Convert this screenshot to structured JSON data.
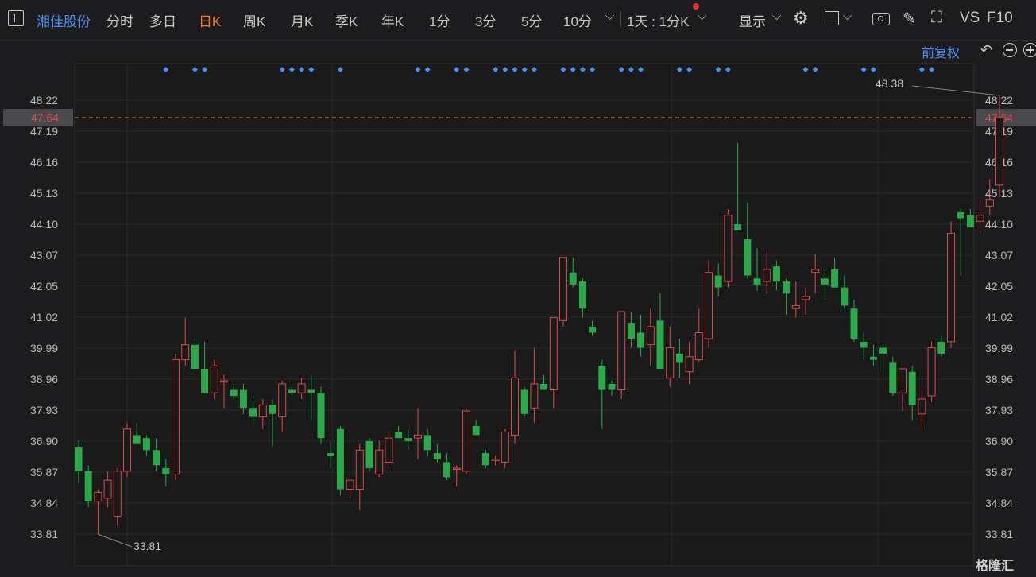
{
  "toolbar": {
    "stock_name": "湘佳股份",
    "tabs": [
      "分时",
      "多日",
      "日K",
      "周K",
      "月K",
      "季K",
      "年K",
      "1分",
      "3分",
      "5分",
      "10分"
    ],
    "active_tab": "日K",
    "period_select": "1天 : 1分K",
    "display_label": "显示",
    "vs_label": "VS",
    "f10_label": "F10"
  },
  "adjust_label": "前复权",
  "watermark": "格隆汇",
  "colors": {
    "up": "#e04848",
    "down": "#2aa84a",
    "accent": "#ff7a1a",
    "link": "#4a8ef0",
    "marker": "#4a8ef0"
  },
  "chart_data": {
    "type": "candlestick",
    "ylim": [
      33.3,
      48.9
    ],
    "y_ticks": [
      "48.22",
      "47.19",
      "46.16",
      "45.13",
      "44.10",
      "43.07",
      "42.05",
      "41.02",
      "39.99",
      "38.96",
      "37.93",
      "36.90",
      "35.87",
      "34.84",
      "33.81"
    ],
    "current_price": "47.64",
    "high_label": "48.38",
    "low_label": "33.81",
    "ohlc": [
      [
        36.7,
        36.9,
        35.5,
        35.9
      ],
      [
        35.9,
        36.1,
        34.7,
        34.9
      ],
      [
        34.9,
        35.3,
        33.8,
        35.2
      ],
      [
        35.0,
        35.9,
        34.7,
        35.6
      ],
      [
        34.4,
        36.0,
        34.1,
        35.9
      ],
      [
        35.9,
        37.5,
        35.7,
        37.3
      ],
      [
        37.1,
        37.5,
        36.8,
        36.8
      ],
      [
        37.0,
        37.1,
        36.4,
        36.6
      ],
      [
        36.6,
        37.0,
        35.9,
        36.1
      ],
      [
        36.0,
        36.3,
        35.4,
        35.8
      ],
      [
        35.8,
        39.8,
        35.6,
        39.6
      ],
      [
        39.6,
        41.0,
        39.4,
        40.1
      ],
      [
        40.1,
        40.3,
        39.2,
        39.3
      ],
      [
        39.3,
        40.2,
        38.5,
        38.5
      ],
      [
        38.5,
        39.6,
        38.3,
        39.4
      ],
      [
        38.9,
        39.1,
        38.0,
        38.9
      ],
      [
        38.6,
        38.8,
        38.3,
        38.4
      ],
      [
        38.6,
        38.8,
        37.8,
        38.0
      ],
      [
        38.0,
        38.4,
        37.4,
        37.7
      ],
      [
        37.7,
        38.3,
        37.3,
        38.1
      ],
      [
        38.1,
        38.3,
        36.7,
        37.8
      ],
      [
        37.7,
        38.9,
        37.2,
        38.8
      ],
      [
        38.6,
        38.8,
        38.4,
        38.5
      ],
      [
        38.5,
        39.0,
        38.3,
        38.8
      ],
      [
        38.6,
        39.1,
        37.6,
        38.5
      ],
      [
        38.5,
        38.7,
        36.8,
        37.0
      ],
      [
        36.5,
        36.9,
        36.0,
        36.4
      ],
      [
        37.3,
        37.4,
        35.1,
        35.3
      ],
      [
        35.3,
        35.6,
        35.0,
        35.6
      ],
      [
        35.3,
        36.8,
        34.6,
        36.6
      ],
      [
        36.9,
        37.0,
        35.9,
        36.0
      ],
      [
        35.8,
        36.9,
        35.7,
        36.6
      ],
      [
        36.2,
        37.2,
        36.0,
        37.0
      ],
      [
        37.2,
        37.4,
        37.0,
        37.0
      ],
      [
        37.0,
        37.3,
        36.6,
        36.9
      ],
      [
        37.0,
        38.0,
        36.3,
        37.1
      ],
      [
        37.1,
        37.3,
        36.4,
        36.6
      ],
      [
        36.5,
        36.8,
        36.2,
        36.3
      ],
      [
        36.2,
        36.5,
        35.6,
        35.7
      ],
      [
        36.0,
        36.1,
        35.4,
        36.0
      ],
      [
        35.9,
        38.0,
        35.8,
        37.9
      ],
      [
        37.4,
        37.6,
        37.1,
        37.1
      ],
      [
        36.5,
        36.6,
        36.0,
        36.1
      ],
      [
        36.3,
        36.4,
        36.1,
        36.3
      ],
      [
        36.2,
        37.3,
        36.0,
        37.2
      ],
      [
        37.1,
        39.9,
        36.8,
        39.0
      ],
      [
        38.6,
        38.7,
        37.7,
        37.8
      ],
      [
        38.0,
        40.0,
        37.5,
        38.8
      ],
      [
        38.8,
        39.1,
        38.6,
        38.6
      ],
      [
        38.6,
        40.7,
        38.0,
        41.0
      ],
      [
        40.9,
        43.0,
        40.7,
        43.0
      ],
      [
        42.5,
        43.0,
        42.0,
        42.1
      ],
      [
        42.2,
        42.3,
        41.0,
        41.3
      ],
      [
        40.7,
        40.9,
        40.4,
        40.5
      ],
      [
        39.4,
        39.6,
        37.3,
        38.6
      ],
      [
        38.8,
        38.9,
        38.4,
        38.6
      ],
      [
        38.6,
        40.0,
        38.3,
        41.2
      ],
      [
        40.8,
        41.2,
        40.0,
        40.3
      ],
      [
        40.5,
        41.1,
        39.7,
        40.0
      ],
      [
        40.1,
        41.3,
        39.4,
        40.7
      ],
      [
        40.9,
        41.8,
        39.3,
        39.3
      ],
      [
        39.0,
        40.7,
        38.7,
        40.0
      ],
      [
        39.8,
        40.3,
        39.0,
        39.5
      ],
      [
        39.2,
        40.2,
        38.8,
        39.7
      ],
      [
        39.6,
        41.3,
        39.5,
        40.5
      ],
      [
        40.3,
        42.9,
        40.0,
        42.5
      ],
      [
        42.4,
        42.8,
        41.7,
        42.0
      ],
      [
        42.2,
        44.6,
        42.0,
        44.4
      ],
      [
        44.1,
        46.8,
        43.9,
        43.9
      ],
      [
        43.6,
        44.8,
        42.3,
        42.4
      ],
      [
        42.3,
        43.3,
        41.9,
        42.1
      ],
      [
        42.2,
        43.2,
        41.8,
        42.6
      ],
      [
        42.7,
        42.9,
        41.9,
        42.2
      ],
      [
        42.2,
        42.3,
        41.1,
        41.8
      ],
      [
        41.3,
        42.2,
        41.0,
        41.4
      ],
      [
        41.6,
        42.0,
        41.1,
        41.7
      ],
      [
        42.5,
        43.1,
        41.8,
        42.6
      ],
      [
        42.3,
        42.6,
        41.6,
        42.1
      ],
      [
        42.6,
        43.0,
        42.0,
        42.0
      ],
      [
        42.0,
        42.4,
        41.3,
        41.4
      ],
      [
        41.3,
        41.6,
        40.2,
        40.3
      ],
      [
        40.2,
        40.5,
        39.6,
        40.0
      ],
      [
        39.7,
        40.1,
        39.4,
        39.6
      ],
      [
        40.0,
        40.1,
        39.2,
        39.8
      ],
      [
        39.5,
        39.7,
        38.4,
        38.5
      ],
      [
        38.5,
        39.3,
        37.9,
        39.3
      ],
      [
        39.2,
        39.4,
        37.6,
        38.1
      ],
      [
        37.8,
        38.6,
        37.3,
        38.3
      ],
      [
        38.4,
        40.2,
        38.2,
        40.0
      ],
      [
        40.2,
        40.4,
        39.7,
        39.8
      ],
      [
        40.2,
        44.2,
        40.0,
        43.8
      ],
      [
        44.5,
        44.6,
        42.4,
        44.3
      ],
      [
        44.4,
        44.6,
        44.0,
        44.0
      ],
      [
        44.2,
        44.9,
        43.8,
        44.4
      ],
      [
        44.7,
        45.6,
        44.4,
        44.9
      ],
      [
        45.4,
        48.38,
        45.0,
        47.64
      ]
    ],
    "x_spacing": 12.2
  }
}
